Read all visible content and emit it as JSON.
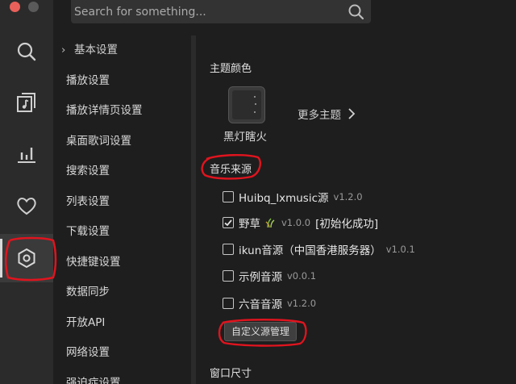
{
  "search": {
    "placeholder": "Search for something..."
  },
  "rail": {
    "items": [
      "search-icon",
      "music-library-icon",
      "chart-bars-icon",
      "heart-icon",
      "settings-hex-icon"
    ],
    "active": "settings-hex-icon"
  },
  "nav": {
    "group_label": "基本设置",
    "items": [
      "播放设置",
      "播放详情页设置",
      "桌面歌词设置",
      "搜索设置",
      "列表设置",
      "下载设置",
      "快捷键设置",
      "数据同步",
      "开放API",
      "网络设置",
      "强迫症设置"
    ]
  },
  "theme": {
    "section_title": "主题颜色",
    "current_name": "黑灯瞎火",
    "more_label": "更多主题"
  },
  "sources": {
    "section_title": "音乐来源",
    "items": [
      {
        "name": "Huibq_lxmusic源",
        "version": "v1.2.0",
        "status": "",
        "checked": false
      },
      {
        "name": "野草",
        "version": "v1.0.0",
        "status": "[初始化成功]",
        "checked": true
      },
      {
        "name": "ikun音源（中国香港服务器）",
        "version": "v1.0.1",
        "status": "",
        "checked": false
      },
      {
        "name": "示例音源",
        "version": "v0.0.1",
        "status": "",
        "checked": false
      },
      {
        "name": "六音音源",
        "version": "v1.2.0",
        "status": "",
        "checked": false
      }
    ],
    "custom_button": "自定义源管理"
  },
  "window_size": {
    "section_title": "窗口尺寸"
  },
  "colors": {
    "annotation_red": "#e0141e",
    "background": "#1e1e1e",
    "rail": "#2b2b2b"
  }
}
